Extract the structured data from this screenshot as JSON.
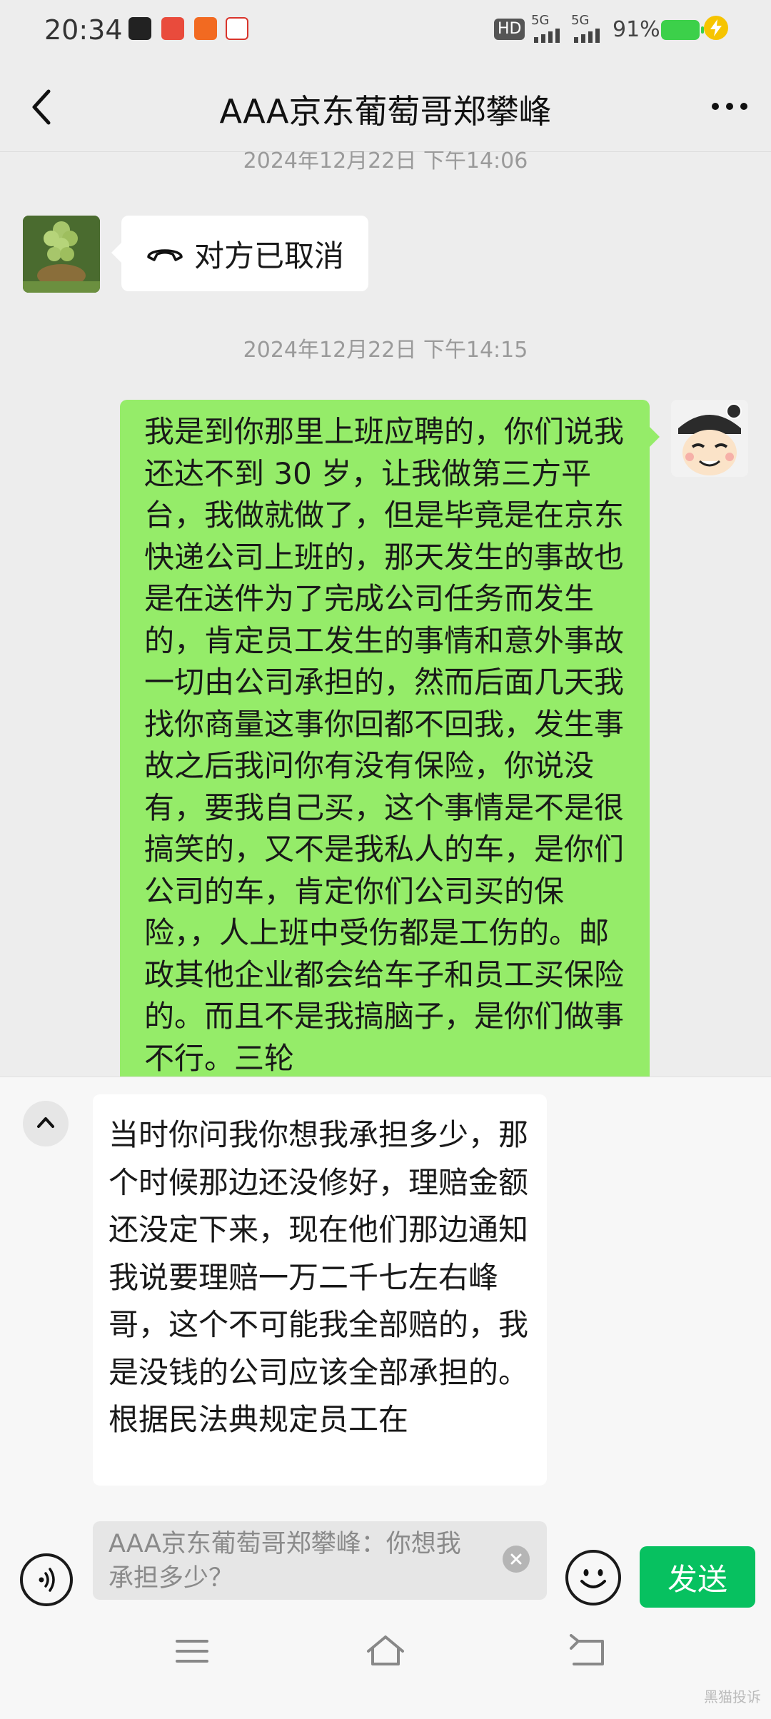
{
  "status_bar": {
    "time": "20:34",
    "signal_1": "5G",
    "signal_2": "5G",
    "battery": "91%",
    "hd_label": "HD"
  },
  "header": {
    "title": "AAA京东葡萄哥郑攀峰"
  },
  "chat": {
    "timestamp_1": "2024年12月22日 下午14:06",
    "call_cancelled": "对方已取消",
    "timestamp_2": "2024年12月22日 下午14:15",
    "my_message": "我是到你那里上班应聘的，你们说我还达不到 30 岁，让我做第三方平台，我做就做了，但是毕竟是在京东快递公司上班的，那天发生的事故也是在送件为了完成公司任务而发生的，肯定员工发生的事情和意外事故一切由公司承担的，然而后面几天我找你商量这事你回都不回我，发生事故之后我问你有没有保险，你说没有，要我自己买，这个事情是不是很搞笑的，又不是我私人的车，是你们公司的车，肯定你们公司买的保险，，人上班中受伤都是工伤的。邮政其他企业都会给车子和员工买保险的。而且不是我搞脑子，是你们做事不行。三轮"
  },
  "input": {
    "draft_text": "当时你问我你想我承担多少，那个时候那边还没修好，理赔金额还没定下来，现在他们那边通知我说要理赔一万二千七左右峰哥，这个不可能我全部赔的，我是没钱的公司应该全部承担的。根据民法典规定员工在",
    "quote_text": "AAA京东葡萄哥郑攀峰：你想我承担多少？",
    "send_label": "发送"
  },
  "watermark": "黑猫投诉",
  "colors": {
    "my_bubble": "#95ec69",
    "send_button": "#07c160",
    "background": "#ededed"
  },
  "icons": [
    "back-arrow-icon",
    "more-dots-icon",
    "hangup-phone-icon",
    "collapse-up-icon",
    "voice-icon",
    "emoji-icon",
    "clear-quote-icon",
    "menu-icon",
    "home-icon",
    "back-nav-icon"
  ]
}
